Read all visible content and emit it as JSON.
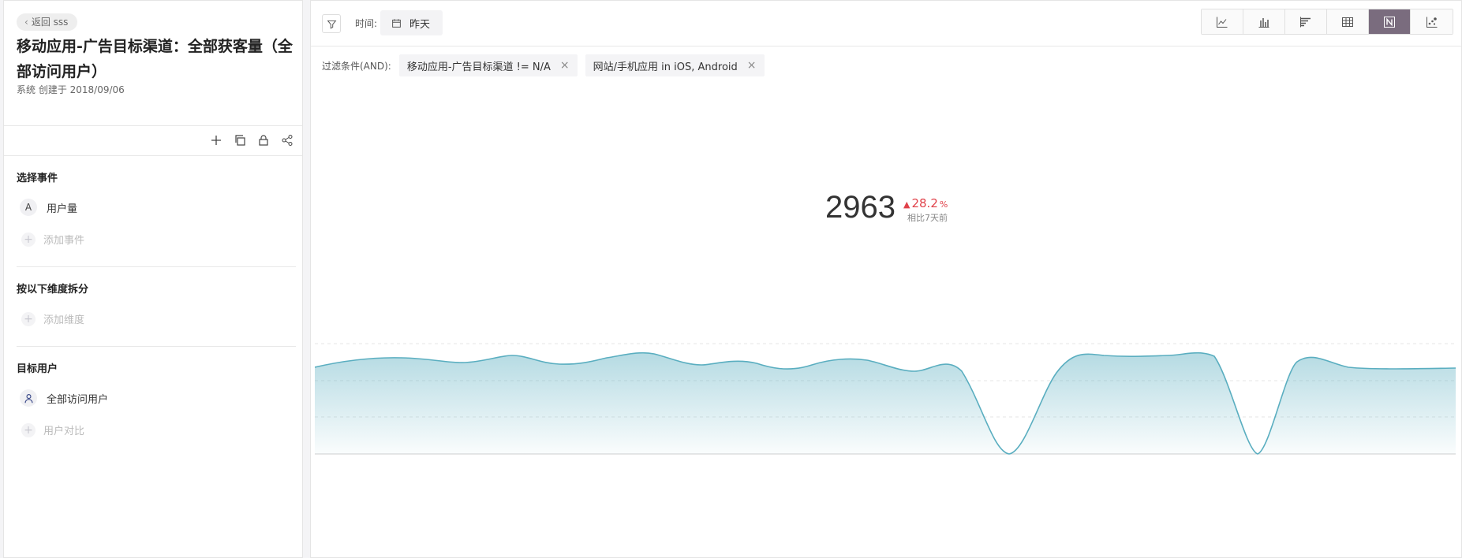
{
  "left": {
    "back_label": "返回 sss",
    "title": "移动应用-广告目标渠道：全部获客量（全部访问用户）",
    "meta": "系统 创建于 2018/09/06",
    "sections": {
      "events": {
        "title": "选择事件",
        "item_badge": "A",
        "item_label": "用户量",
        "add_label": "添加事件"
      },
      "dimensions": {
        "title": "按以下维度拆分",
        "add_label": "添加维度"
      },
      "users": {
        "title": "目标用户",
        "item_label": "全部访问用户",
        "add_label": "用户对比"
      }
    }
  },
  "right": {
    "time_label": "时间:",
    "time_value": "昨天",
    "filters_label": "过滤条件(AND):",
    "filters": [
      "移动应用-广告目标渠道 != N/A",
      "网站/手机应用 in iOS, Android"
    ],
    "chart_types_active": "number",
    "metric": {
      "value": "2963",
      "delta": "28.2",
      "delta_unit": "%",
      "compare_label": "相比7天前",
      "delta_color": "#e0424a"
    },
    "accent_color": "#5aaec0"
  }
}
